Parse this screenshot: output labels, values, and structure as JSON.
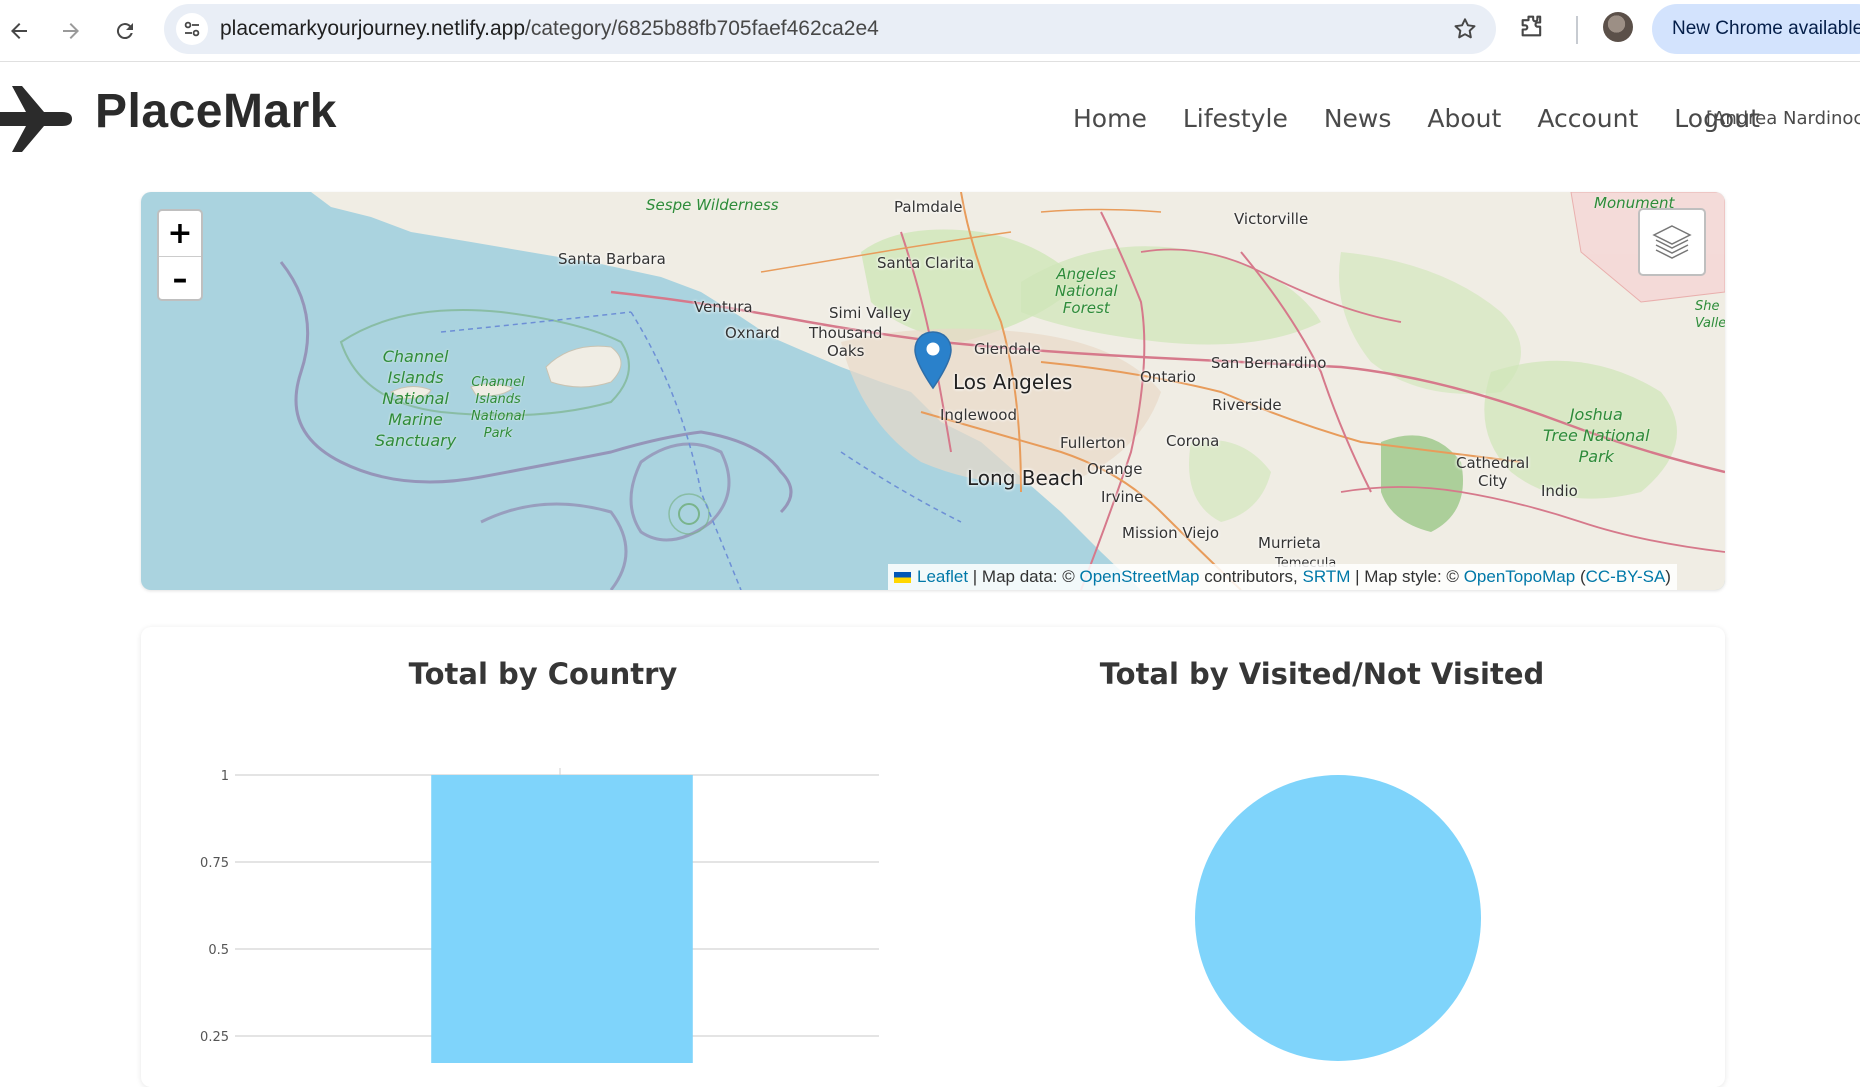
{
  "browser": {
    "url_host": "placemarkyourjourney.netlify.app",
    "url_path": "/category/6825b88fb705faef462ca2e4",
    "update_button": "New Chrome available",
    "icons": [
      "back-icon",
      "forward-icon",
      "reload-icon",
      "site-info-icon",
      "bookmark-star-icon",
      "extensions-icon"
    ]
  },
  "navbar": {
    "brand": "PlaceMark",
    "brand_icon": "airplane-icon",
    "links": [
      "Home",
      "Lifestyle",
      "News",
      "About",
      "Account",
      "Logout"
    ],
    "user": "[Andrea Nardinocch"
  },
  "map": {
    "zoom_in": "+",
    "zoom_out": "–",
    "layers_icon": "layers-icon",
    "marker_icon": "map-marker-icon",
    "marker_color": "#2a81cb",
    "labels": {
      "sespe": "Sespe Wilderness",
      "palmdale": "Palmdale",
      "victorville": "Victorville",
      "monument": "Monument",
      "santa_barbara": "Santa Barbara",
      "santa_clarita": "Santa Clarita",
      "angeles_forest": "Angeles\nNational\nForest",
      "ventura": "Ventura",
      "simi_valley": "Simi Valley",
      "oxnard": "Oxnard",
      "thousand_oaks": "Thousand\nOaks",
      "glendale": "Glendale",
      "los_angeles": "Los Angeles",
      "ontario": "Ontario",
      "san_bernardino": "San Bernardino",
      "channel_sanctuary": "Channel\nIslands\nNational\nMarine\nSanctuary",
      "channel_park": "Channel\nIslands\nNational\nPark",
      "inglewood": "Inglewood",
      "riverside": "Riverside",
      "fullerton": "Fullerton",
      "corona": "Corona",
      "long_beach": "Long Beach",
      "orange": "Orange",
      "irvine": "Irvine",
      "mission_viejo": "Mission Viejo",
      "murrieta": "Murrieta",
      "joshua_tree": "Joshua\nTree National\nPark",
      "cathedral_city": "Cathedral\nCity",
      "indio": "Indio",
      "she_valley": "She\nValley",
      "temecula": "Temecula"
    },
    "attribution": {
      "leaflet": "Leaflet",
      "part1": " | Map data: © ",
      "osm": "OpenStreetMap",
      "part2": " contributors, ",
      "srtm": "SRTM",
      "part3": " | Map style: © ",
      "opentopo": "OpenTopoMap",
      "part4": " (",
      "license": "CC-BY-SA",
      "part5": ")"
    }
  },
  "charts": {
    "bar_title": "Total by Country",
    "pie_title": "Total by Visited/Not Visited",
    "bar_color": "#7fd4fb",
    "pie_color": "#7fd4fb"
  },
  "chart_data": [
    {
      "type": "bar",
      "title": "Total by Country",
      "categories": [
        ""
      ],
      "values": [
        1
      ],
      "ylim": [
        0,
        1
      ],
      "yticks": [
        "1",
        "0.75",
        "0.5",
        "0.25"
      ],
      "grid": true
    },
    {
      "type": "pie",
      "title": "Total by Visited/Not Visited",
      "slices": [
        {
          "value": 1
        }
      ]
    }
  ]
}
